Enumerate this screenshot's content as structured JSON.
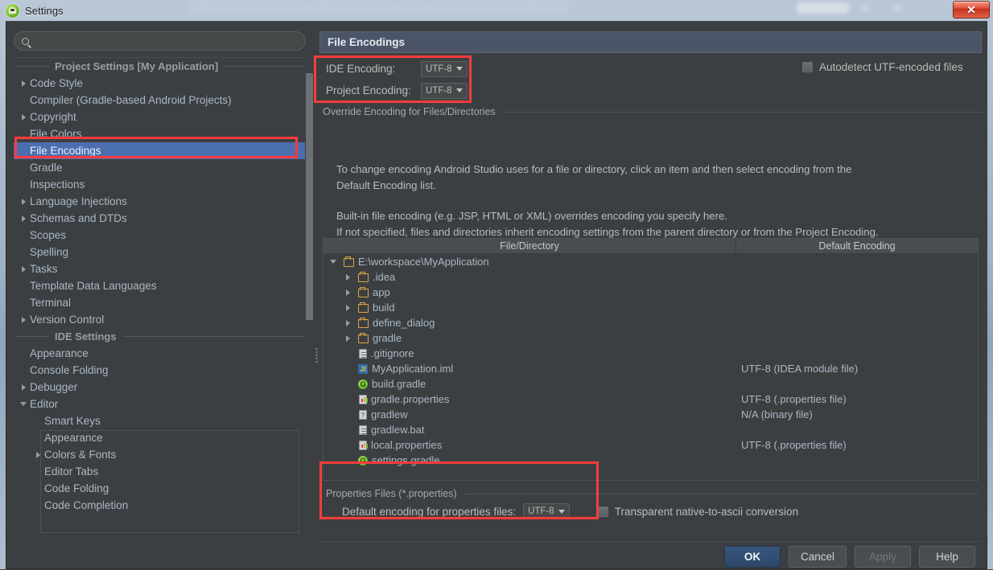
{
  "window": {
    "title": "Settings",
    "app_icon": "android-studio-icon",
    "close_label": "✕"
  },
  "search": {
    "placeholder": "",
    "value": "",
    "icon": "search-icon"
  },
  "sidebar": {
    "sections": [
      {
        "title": "Project Settings [My Application]",
        "items": [
          {
            "label": "Code Style",
            "arrow": "right",
            "indent": 1,
            "selected": false
          },
          {
            "label": "Compiler (Gradle-based Android Projects)",
            "arrow": "none",
            "indent": 1,
            "selected": false
          },
          {
            "label": "Copyright",
            "arrow": "right",
            "indent": 1,
            "selected": false
          },
          {
            "label": "File Colors",
            "arrow": "none",
            "indent": 1,
            "selected": false
          },
          {
            "label": "File Encodings",
            "arrow": "none",
            "indent": 1,
            "selected": true
          },
          {
            "label": "Gradle",
            "arrow": "none",
            "indent": 1,
            "selected": false
          },
          {
            "label": "Inspections",
            "arrow": "none",
            "indent": 1,
            "selected": false
          },
          {
            "label": "Language Injections",
            "arrow": "right",
            "indent": 1,
            "selected": false
          },
          {
            "label": "Schemas and DTDs",
            "arrow": "right",
            "indent": 1,
            "selected": false
          },
          {
            "label": "Scopes",
            "arrow": "none",
            "indent": 1,
            "selected": false
          },
          {
            "label": "Spelling",
            "arrow": "none",
            "indent": 1,
            "selected": false
          },
          {
            "label": "Tasks",
            "arrow": "right",
            "indent": 1,
            "selected": false
          },
          {
            "label": "Template Data Languages",
            "arrow": "none",
            "indent": 1,
            "selected": false
          },
          {
            "label": "Terminal",
            "arrow": "none",
            "indent": 1,
            "selected": false
          },
          {
            "label": "Version Control",
            "arrow": "right",
            "indent": 1,
            "selected": false
          }
        ]
      },
      {
        "title": "IDE Settings",
        "items": [
          {
            "label": "Appearance",
            "arrow": "none",
            "indent": 1,
            "selected": false
          },
          {
            "label": "Console Folding",
            "arrow": "none",
            "indent": 1,
            "selected": false
          },
          {
            "label": "Debugger",
            "arrow": "right",
            "indent": 1,
            "selected": false
          },
          {
            "label": "Editor",
            "arrow": "down",
            "indent": 1,
            "selected": false
          },
          {
            "label": "Smart Keys",
            "arrow": "none",
            "indent": 2,
            "selected": false
          },
          {
            "label": "Appearance",
            "arrow": "none",
            "indent": 2,
            "selected": false
          },
          {
            "label": "Colors & Fonts",
            "arrow": "right",
            "indent": 2,
            "selected": false
          },
          {
            "label": "Editor Tabs",
            "arrow": "none",
            "indent": 2,
            "selected": false
          },
          {
            "label": "Code Folding",
            "arrow": "none",
            "indent": 2,
            "selected": false
          },
          {
            "label": "Code Completion",
            "arrow": "none",
            "indent": 2,
            "selected": false
          }
        ]
      }
    ]
  },
  "panel": {
    "title": "File Encodings",
    "ide_encoding": {
      "label": "IDE Encoding:",
      "value": "UTF-8"
    },
    "project_encoding": {
      "label": "Project Encoding:",
      "value": "UTF-8"
    },
    "autodetect": {
      "label": "Autodetect UTF-encoded files",
      "checked": false
    },
    "override_group_title": "Override Encoding for Files/Directories",
    "description": {
      "line1": "To change encoding Android Studio uses for a file or directory, click an item and then select encoding from the",
      "line2": "Default Encoding list.",
      "line3": "Built-in file encoding (e.g. JSP, HTML or XML) overrides encoding you specify here.",
      "line4": "If not specified, files and directories inherit encoding settings from the parent directory or from the Project Encoding."
    },
    "table": {
      "columns": [
        "File/Directory",
        "Default Encoding"
      ],
      "rows": [
        {
          "name": "E:\\workspace\\MyApplication",
          "icon": "folder-icon",
          "arrow": "down",
          "indent": 0,
          "encoding": ""
        },
        {
          "name": ".idea",
          "icon": "folder-icon",
          "arrow": "right",
          "indent": 1,
          "encoding": ""
        },
        {
          "name": "app",
          "icon": "folder-icon",
          "arrow": "right",
          "indent": 1,
          "encoding": ""
        },
        {
          "name": "build",
          "icon": "folder-icon",
          "arrow": "right",
          "indent": 1,
          "encoding": ""
        },
        {
          "name": "define_dialog",
          "icon": "folder-icon",
          "arrow": "right",
          "indent": 1,
          "encoding": ""
        },
        {
          "name": "gradle",
          "icon": "folder-icon",
          "arrow": "right",
          "indent": 1,
          "encoding": ""
        },
        {
          "name": ".gitignore",
          "icon": "text-file-icon",
          "arrow": "none",
          "indent": 1,
          "encoding": ""
        },
        {
          "name": "MyApplication.iml",
          "icon": "iml-file-icon",
          "arrow": "none",
          "indent": 1,
          "encoding": "UTF-8 (IDEA module file)"
        },
        {
          "name": "build.gradle",
          "icon": "gradle-file-icon",
          "arrow": "none",
          "indent": 1,
          "encoding": ""
        },
        {
          "name": "gradle.properties",
          "icon": "properties-file-icon",
          "arrow": "none",
          "indent": 1,
          "encoding": "UTF-8 (.properties file)"
        },
        {
          "name": "gradlew",
          "icon": "unknown-file-icon",
          "arrow": "none",
          "indent": 1,
          "encoding": "N/A (binary file)"
        },
        {
          "name": "gradlew.bat",
          "icon": "text-file-icon",
          "arrow": "none",
          "indent": 1,
          "encoding": ""
        },
        {
          "name": "local.properties",
          "icon": "properties-file-icon",
          "arrow": "none",
          "indent": 1,
          "encoding": "UTF-8 (.properties file)"
        },
        {
          "name": "settings.gradle",
          "icon": "gradle-file-icon",
          "arrow": "none",
          "indent": 1,
          "encoding": ""
        }
      ]
    },
    "properties_group": {
      "title": "Properties Files (*.properties)",
      "default_encoding_label": "Default encoding for properties files:",
      "default_encoding_value": "UTF-8",
      "transparent": {
        "label": "Transparent native-to-ascii conversion",
        "checked": false
      }
    }
  },
  "footer": {
    "ok": "OK",
    "cancel": "Cancel",
    "apply": "Apply",
    "help": "Help"
  },
  "colors": {
    "background": "#3c3f41",
    "selection": "#4b6eaf",
    "header": "#4c5568",
    "text": "#bbbbbb",
    "tree_text": "#a9b7c6",
    "annotation": "#fa3c3c",
    "folder": "#d9a441",
    "primary_button": "#2d4668"
  }
}
